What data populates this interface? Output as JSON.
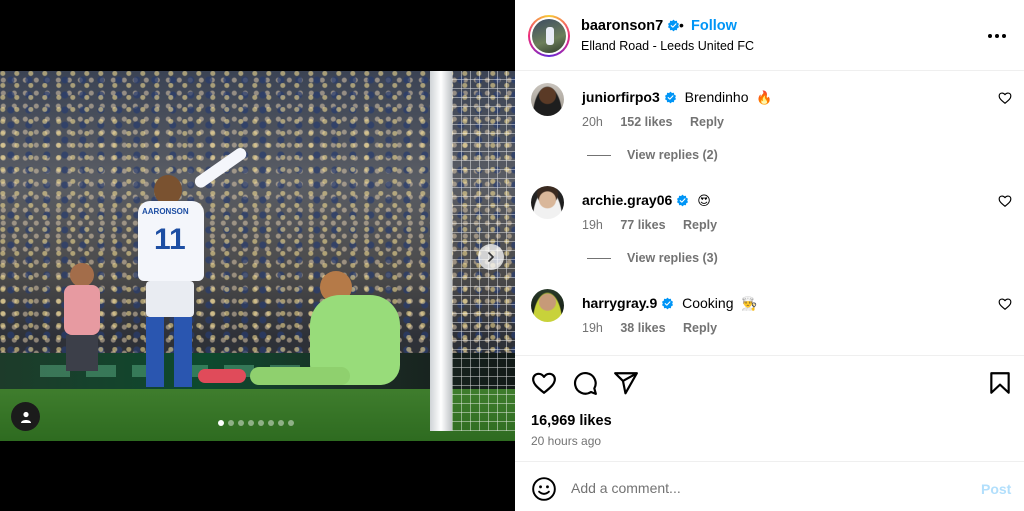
{
  "post": {
    "author": "baaronson7",
    "follow_label": "Follow",
    "separator": "•",
    "location": "Elland Road - Leeds United FC",
    "jersey_name": "AARONSON",
    "jersey_number": "11",
    "carousel": {
      "total": 8,
      "active_index": 0
    },
    "likes": "16,969 likes",
    "time_ago": "20 hours ago"
  },
  "comments": [
    {
      "user": "juniorfirpo3",
      "text": "Brendinho",
      "emoji": "🔥",
      "age": "20h",
      "likes": "152 likes",
      "reply_label": "Reply",
      "view_replies": "View replies (2)"
    },
    {
      "user": "archie.gray06",
      "text": "",
      "emoji": "😍",
      "age": "19h",
      "likes": "77 likes",
      "reply_label": "Reply",
      "view_replies": "View replies (3)"
    },
    {
      "user": "harrygray.9",
      "text": "Cooking",
      "emoji": "👨‍🍳",
      "age": "19h",
      "likes": "38 likes",
      "reply_label": "Reply"
    }
  ],
  "composer": {
    "placeholder": "Add a comment...",
    "post_label": "Post"
  },
  "icons": {
    "like": "heart-icon",
    "comment": "comment-icon",
    "share": "share-icon",
    "save": "bookmark-icon",
    "more": "more-options-icon",
    "emoji": "emoji-icon",
    "verified": "verified-badge-icon",
    "next": "chevron-right-icon",
    "tag": "user-tag-icon"
  },
  "colors": {
    "accent": "#0095f6",
    "muted": "#737373",
    "post_disabled": "#b2dffc"
  }
}
